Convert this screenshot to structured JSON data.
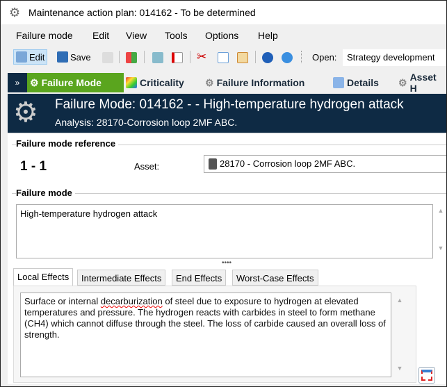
{
  "window": {
    "title": "Maintenance action plan: 014162  - To be determined"
  },
  "menu": [
    "Failure mode",
    "Edit",
    "View",
    "Tools",
    "Options",
    "Help"
  ],
  "toolbar": {
    "edit": "Edit",
    "save": "Save",
    "open_label": "Open:",
    "open_value": "Strategy development"
  },
  "nav_tabs": [
    "Failure Mode",
    "Criticality",
    "Failure Information",
    "Details",
    "Asset H"
  ],
  "header": {
    "title": "Failure Mode: 014162 -   - High-temperature hydrogen attack",
    "subtitle": "Analysis: 28170-Corrosion loop 2MF ABC."
  },
  "reference": {
    "title": "Failure mode reference",
    "number": "1 - 1",
    "asset_label": "Asset:",
    "asset_value": "28170 - Corrosion loop 2MF ABC."
  },
  "failure_mode": {
    "title": "Failure mode",
    "value": "High-temperature hydrogen attack"
  },
  "effect_tabs": [
    "Local Effects",
    "Intermediate Effects",
    "End Effects",
    "Worst-Case Effects"
  ],
  "effects": {
    "pre": "Surface or internal ",
    "misspelled": "decarburization",
    "post": " of steel due to exposure to hydrogen at elevated temperatures and pressure. The hydrogen reacts with carbides in steel to form methane (CH4) which cannot diffuse through the steel. The loss of carbide caused an overall loss of strength."
  },
  "colors": {
    "header_bg": "#0e2a44",
    "active_tab": "#5aa51e"
  }
}
